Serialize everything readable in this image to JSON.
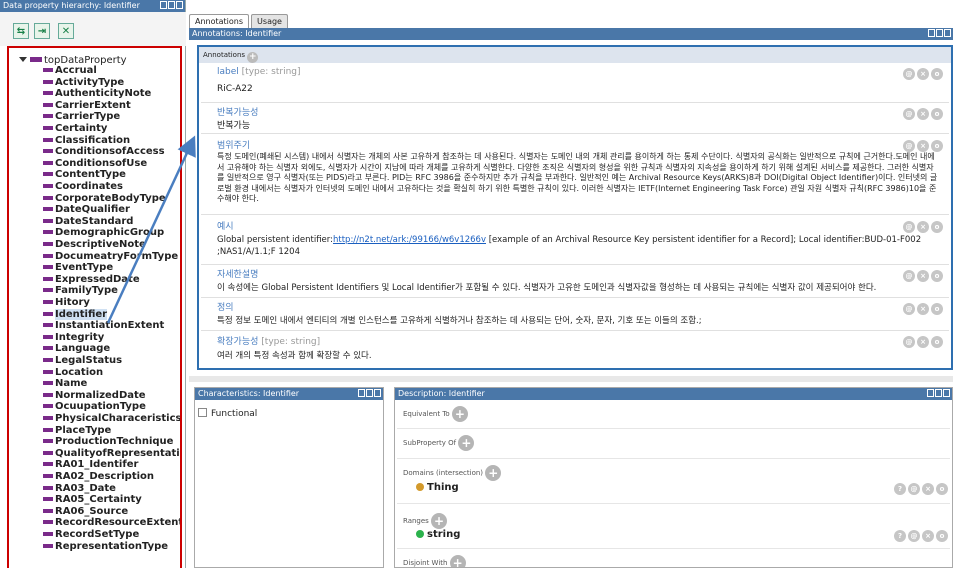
{
  "left_panel": {
    "title": "Data property hierarchy: Identifier",
    "toolbar_icons": [
      "add-subproperty-icon",
      "add-sibling-icon",
      "delete-icon"
    ],
    "root": "topDataProperty",
    "items": [
      "Accrual",
      "ActivityType",
      "AuthenticityNote",
      "CarrierExtent",
      "CarrierType",
      "Certainty",
      "Classification",
      "ConditionsofAccess",
      "ConditionsofUse",
      "ContentType",
      "Coordinates",
      "CorporateBodyType",
      "DateQualifier",
      "DateStandard",
      "DemographicGroup",
      "DescriptiveNote",
      "DocumeatryFormType",
      "EventType",
      "ExpressedDate",
      "FamilyType",
      "Hitory",
      "Identifier",
      "InstantiationExtent",
      "Integrity",
      "Language",
      "LegalStatus",
      "Location",
      "Name",
      "NormalizedDate",
      "OcuupationType",
      "PhysicalCharaceristics",
      "PlaceType",
      "ProductionTechnique",
      "QualityofRepresentation",
      "RA01_Identifer",
      "RA02_Description",
      "RA03_Date",
      "RA05_Certainty",
      "RA06_Source",
      "RecordResourceExtent",
      "RecordSetType",
      "RepresentationType"
    ],
    "selected": "Identifier"
  },
  "tabs": [
    "Annotations",
    "Usage"
  ],
  "annotations_panel": {
    "title": "Annotations: Identifier",
    "header": "Annotations",
    "entries": [
      {
        "label": "label",
        "meta": "[type: string]",
        "value": "RiC-A22"
      },
      {
        "label": "반복가능성",
        "meta": "",
        "value": "반복가능"
      },
      {
        "label": "범위주기",
        "meta": "",
        "value": "특정 도메인(폐쇄된 시스템) 내에서 식별자는 개체의 사본 고유하게 참조하는 데 사용된다. 식별자는 도메인 내의 개체 관리를 용이하게 하는 통제 수단이다. 식별자의 공식화는 일반적으로 규칙에 근거한다.도메인 내에서 고유해야 하는 식별자 외에도, 식별자가 시간이 지남에 따라 개체를 고유하게 식별한다. 다양한 조직은 식별자의 형성을 위한 규칙과 식별자의 지속성을 용이하게 하기 위해 설계된 서비스를 제공한다. 그러한 식별자를 일반적으로 영구 식별자(또는 PIDS)라고 부른다. PID는 RFC 3986을 준수하지만 추가 규칙을 부과한다. 일반적인 예는 Archival Resource Keys(ARKS)8과 DOI(Digital Object Identifier)이다. 인터넷의 글로벌 환경 내에서는 식별자가 인터넷의 도메인 내에서 고유하다는 것을 확실히 하기 위한 특별한 규칙이 있다. 이러한 식별자는 IETF(Internet Engineering Task Force) 관일 자원 식별자 규칙(RFC 3986)10을 준수해야 한다."
      },
      {
        "label": "예시",
        "meta": "",
        "value_before": "Global persistent identifier:",
        "link": "http://n2t.net/ark:/99166/w6v1266v",
        "value_after": " [example of an Archival Resource Key persistent identifier for a Record]; Local identifier:BUD-01-F002 ;NAS1/A/1.1;F 1204"
      },
      {
        "label": "자세한설명",
        "meta": "",
        "value": "이 속성에는 Global Persistent Identifiers 및 Local Identifier가 포함될 수 있다. 식별자가 고유한 도메인과 식별자값을 형성하는 데 사용되는 규칙에는 식별자 값이 제공되어야 한다."
      },
      {
        "label": "정의",
        "meta": "",
        "value": "특정 정보 도메인 내에서 엔티티의 개별 인스턴스를 고유하게 식별하거나 참조하는 데 사용되는 단어, 숫자, 문자, 기호 또는 이들의 조합.;"
      },
      {
        "label": "확장가능성",
        "meta": "[type: string]",
        "value": "여러 개의 특정 속성과 함께 확장할 수 있다."
      }
    ]
  },
  "characteristics_panel": {
    "title": "Characteristics: Identifier",
    "checkbox_label": "Functional"
  },
  "description_panel": {
    "title": "Description: Identifier",
    "sections": {
      "equivalent_to": "Equivalent To",
      "subproperty_of": "SubProperty Of",
      "domains": "Domains (intersection)",
      "domain_value": "Thing",
      "ranges": "Ranges",
      "range_value": "string",
      "disjoint_with": "Disjoint With"
    }
  },
  "colors": {
    "title_bar": "#4a77a8",
    "highlight_red": "#cc0000",
    "highlight_blue": "#2e6fb0",
    "property_bar": "#7a2a8a",
    "thing_dot": "#d39a2c",
    "string_dot": "#2bb24c"
  }
}
